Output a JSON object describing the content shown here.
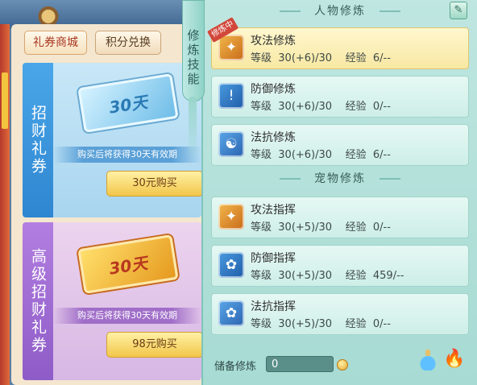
{
  "shop": {
    "tabs": [
      {
        "label": "礼券商城",
        "active": true
      },
      {
        "label": "积分兑换",
        "active": false
      }
    ],
    "cards": [
      {
        "side_label": "招财礼券",
        "ticket_text": "30天",
        "description": "购买后将获得30天有效期",
        "buy_label": "30元购买"
      },
      {
        "side_label": "高级招财礼券",
        "ticket_text": "30天",
        "description": "购买后将获得30天有效期",
        "buy_label": "98元购买"
      }
    ]
  },
  "side_tab": {
    "label": "修炼技能"
  },
  "panel": {
    "character_header": "人物修炼",
    "pet_header": "宠物修炼",
    "character_skills": [
      {
        "name": "攻法修炼",
        "level_label": "等级",
        "level": "30(+6)/30",
        "exp_label": "经验",
        "exp": "6/--",
        "selected": true,
        "badge": "修炼中",
        "icon": "attack-icon"
      },
      {
        "name": "防御修炼",
        "level_label": "等级",
        "level": "30(+6)/30",
        "exp_label": "经验",
        "exp": "0/--",
        "selected": false,
        "icon": "defense-icon"
      },
      {
        "name": "法抗修炼",
        "level_label": "等级",
        "level": "30(+6)/30",
        "exp_label": "经验",
        "exp": "6/--",
        "selected": false,
        "icon": "resist-icon"
      }
    ],
    "pet_skills": [
      {
        "name": "攻法指挥",
        "level_label": "等级",
        "level": "30(+5)/30",
        "exp_label": "经验",
        "exp": "0/--",
        "icon": "paw-attack-icon"
      },
      {
        "name": "防御指挥",
        "level_label": "等级",
        "level": "30(+5)/30",
        "exp_label": "经验",
        "exp": "459/--",
        "icon": "paw-defense-icon"
      },
      {
        "name": "法抗指挥",
        "level_label": "等级",
        "level": "30(+5)/30",
        "exp_label": "经验",
        "exp": "0/--",
        "icon": "paw-resist-icon"
      }
    ],
    "reserve_label": "储备修炼",
    "reserve_value": "0"
  }
}
